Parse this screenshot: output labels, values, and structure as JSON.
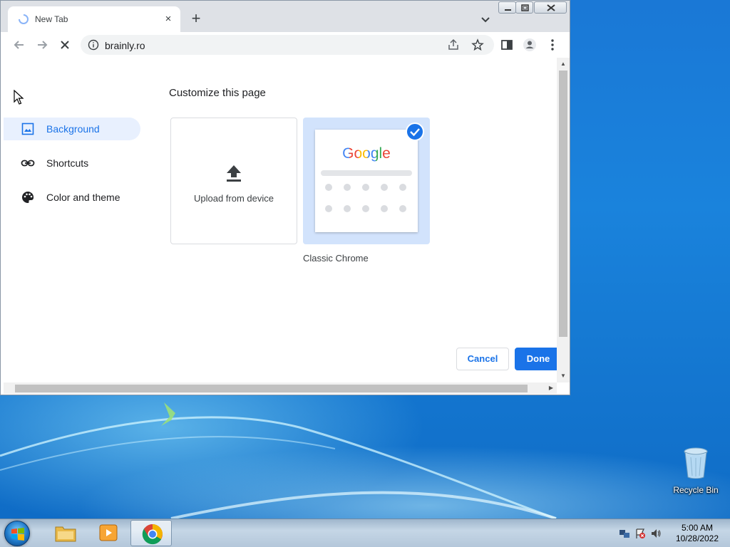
{
  "browser": {
    "tab_title": "New Tab",
    "tab_close": "×",
    "new_tab": "+",
    "url": "brainly.ro"
  },
  "customize_dialog": {
    "title": "Customize this page",
    "sidebar": [
      {
        "label": "Background",
        "icon": "image-icon",
        "selected": true
      },
      {
        "label": "Shortcuts",
        "icon": "link-icon",
        "selected": false
      },
      {
        "label": "Color and theme",
        "icon": "palette-icon",
        "selected": false
      }
    ],
    "upload_tile_label": "Upload from device",
    "classic_tile_label": "Classic Chrome",
    "classic_logo": "Google",
    "cancel_label": "Cancel",
    "done_label": "Done"
  },
  "desktop": {
    "recycle_bin_label": "Recycle Bin"
  },
  "taskbar": {
    "time": "5:00 AM",
    "date": "10/28/2022"
  },
  "colors": {
    "accent": "#1a73e8",
    "selected_bg": "#e8f0fe",
    "tile_selected_bg": "#d2e3fc"
  }
}
